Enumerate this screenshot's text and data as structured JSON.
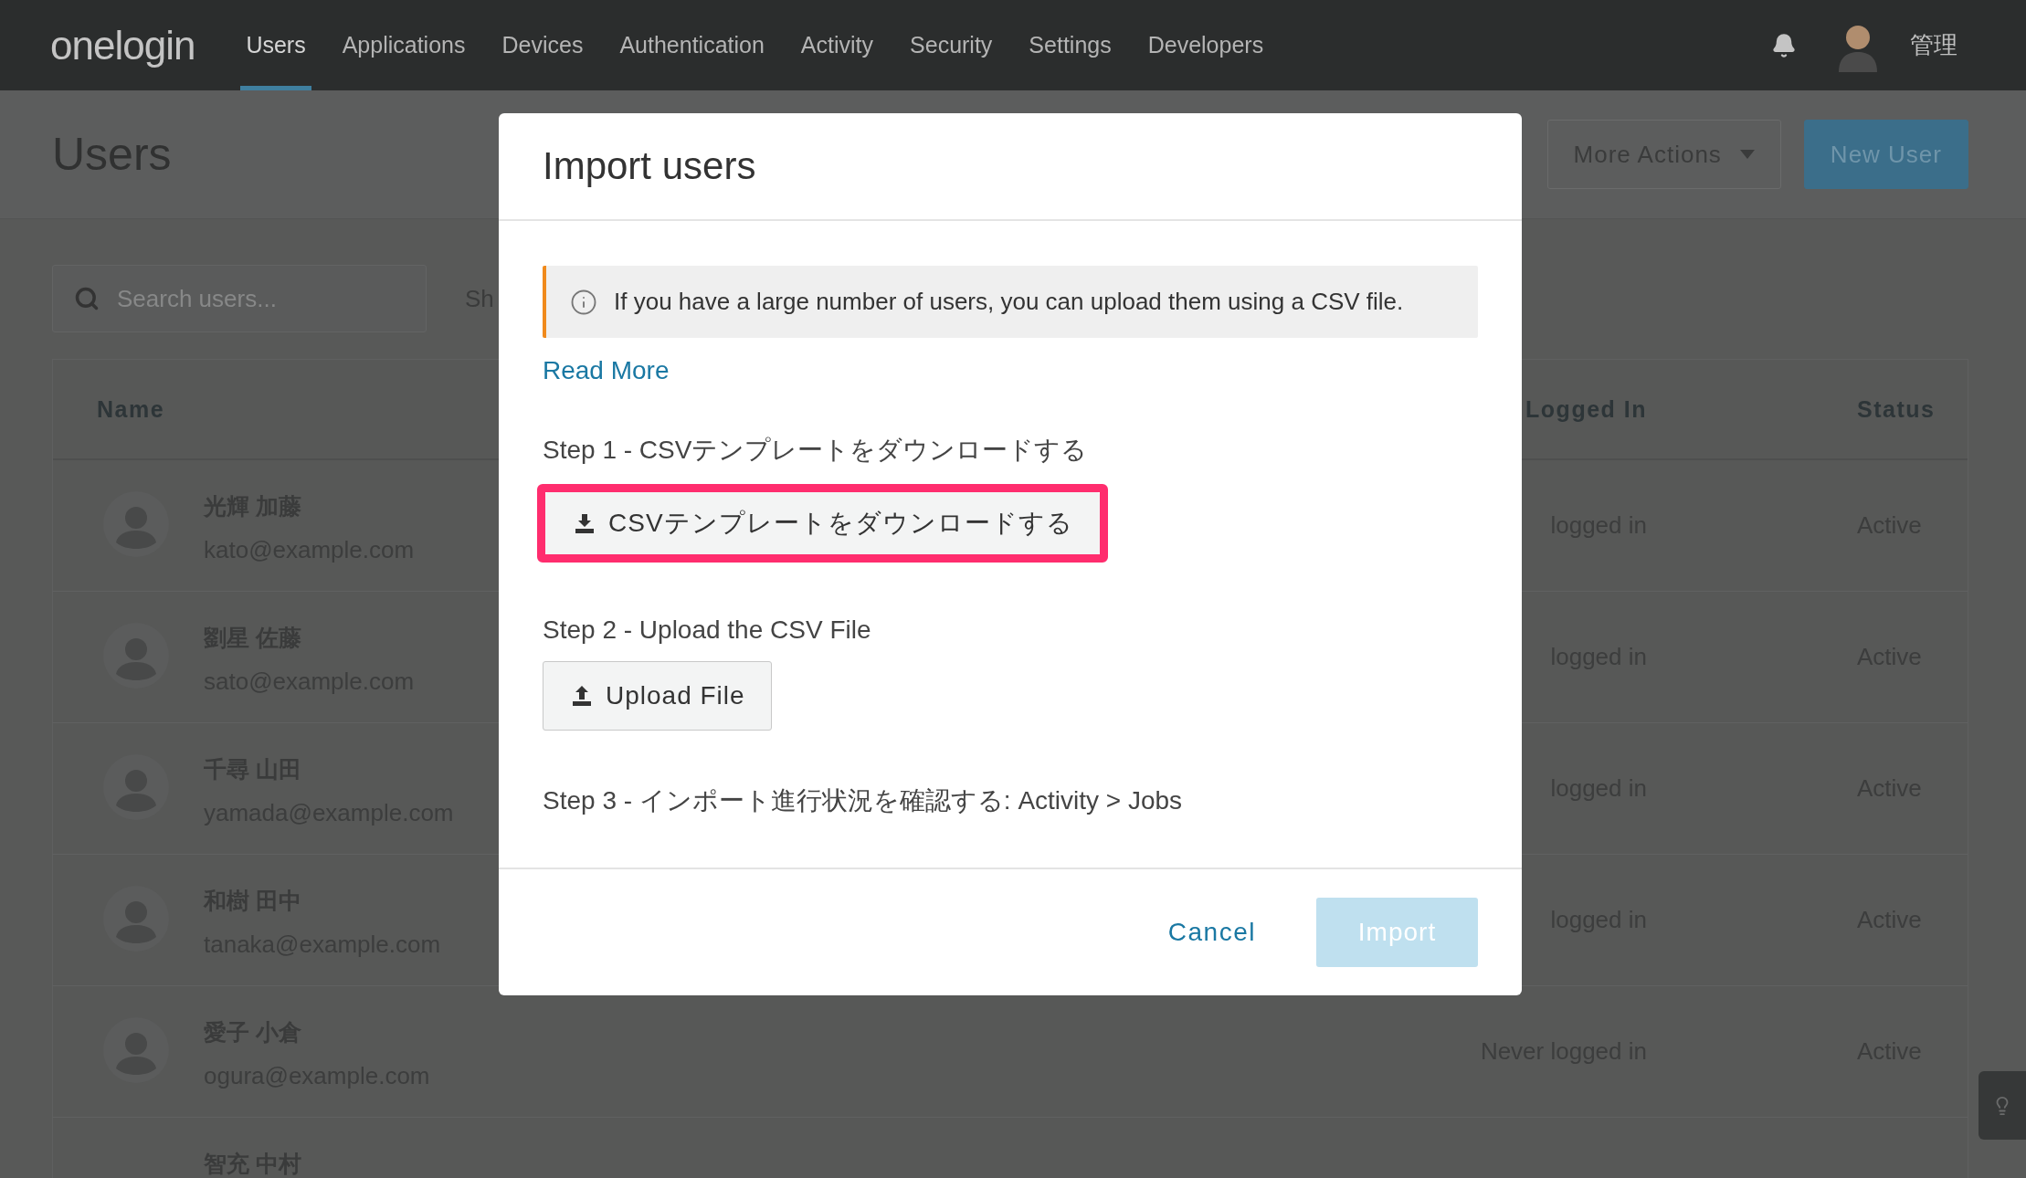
{
  "nav": {
    "logo": "onelogin",
    "items": [
      {
        "label": "Users",
        "selected": true
      },
      {
        "label": "Applications",
        "selected": false
      },
      {
        "label": "Devices",
        "selected": false
      },
      {
        "label": "Authentication",
        "selected": false
      },
      {
        "label": "Activity",
        "selected": false
      },
      {
        "label": "Security",
        "selected": false
      },
      {
        "label": "Settings",
        "selected": false
      },
      {
        "label": "Developers",
        "selected": false
      }
    ],
    "user_label": "管理"
  },
  "page": {
    "title": "Users",
    "actions": [
      {
        "label": "More Actions",
        "kind": "dropdown"
      },
      {
        "label": "New User",
        "kind": "primary"
      }
    ]
  },
  "search": {
    "placeholder": "Search users..."
  },
  "filter_label": "Sh",
  "table": {
    "columns": [
      "Name",
      "Logged In",
      "Status"
    ],
    "rows": [
      {
        "name": "光輝 加藤",
        "email": "kato@example.com",
        "last_login": "logged in",
        "status": "Active"
      },
      {
        "name": "劉星 佐藤",
        "email": "sato@example.com",
        "last_login": "logged in",
        "status": "Active"
      },
      {
        "name": "千尋 山田",
        "email": "yamada@example.com",
        "last_login": "logged in",
        "status": "Active"
      },
      {
        "name": "和樹 田中",
        "email": "tanaka@example.com",
        "last_login": "logged in",
        "status": "Active"
      },
      {
        "name": "愛子 小倉",
        "email": "ogura@example.com",
        "last_login": "Never logged in",
        "status": "Active"
      },
      {
        "name": "智充 中村"
      }
    ]
  },
  "modal": {
    "title": "Import users",
    "info": "If you have a large number of users, you can upload them using a CSV file.",
    "read_more": "Read More",
    "steps": [
      {
        "label": "Step 1 - CSVテンプレートをダウンロードする",
        "button": {
          "label": "CSVテンプレートをダウンロードする",
          "kind": "download",
          "highlighted": true
        }
      },
      {
        "label": "Step 2 - Upload the CSV File",
        "button": {
          "label": "Upload File",
          "kind": "upload",
          "highlighted": false
        }
      },
      {
        "label": "Step 3 - インポート進行状況を確認する: Activity > Jobs"
      }
    ],
    "cancel": "Cancel",
    "submit": {
      "label": "Import",
      "disabled": true
    }
  }
}
